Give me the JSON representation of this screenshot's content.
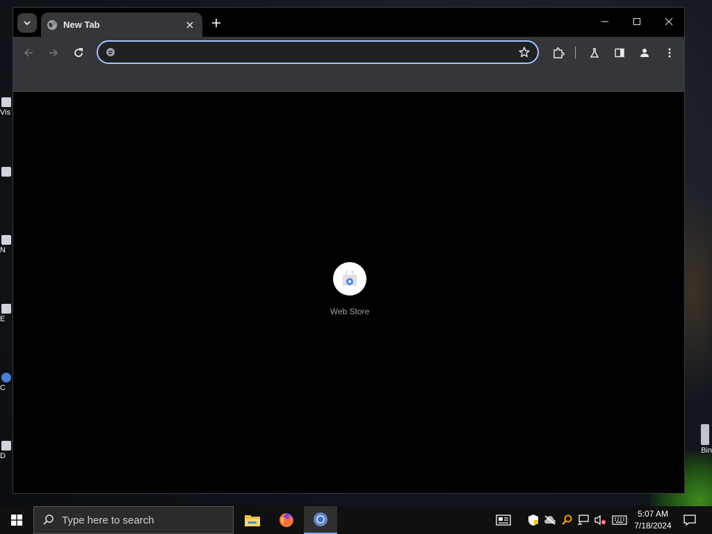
{
  "browser": {
    "tab_title": "New Tab",
    "omnibox_value": "",
    "omnibox_placeholder": "",
    "shortcut_label": "Web Store"
  },
  "taskbar": {
    "search_placeholder": "Type here to search",
    "time": "5:07 AM",
    "date": "7/18/2024"
  },
  "desktop": {
    "icons_left": [
      "Vis",
      "N",
      "E",
      "C",
      "D"
    ],
    "icon_right": "Bin"
  },
  "colors": {
    "omnibox_focus": "#a8c7fa",
    "toolbar_bg": "#35363a",
    "tab_bg": "#35363a",
    "taskbar_bg": "#101010",
    "chrome_active_indicator": "#7aa7e8"
  },
  "icons": {
    "tab_search": "chevron-down-icon",
    "tab_favicon": "globe-icon",
    "tab_close": "close-icon",
    "new_tab": "plus-icon",
    "back": "arrow-left-icon",
    "forward": "arrow-right-icon",
    "reload": "reload-icon",
    "bookmark": "star-icon",
    "extensions": "puzzle-icon",
    "labs": "flask-icon",
    "side_panel": "side-panel-icon",
    "profile": "person-icon",
    "menu": "kebab-menu-icon"
  }
}
